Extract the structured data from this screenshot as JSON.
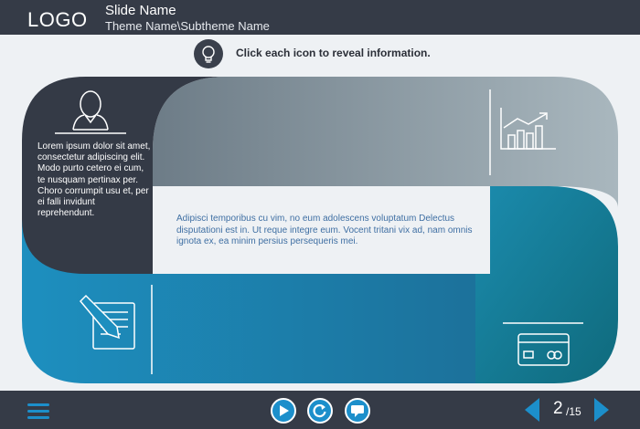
{
  "header": {
    "logo": "LOGO",
    "slide_name": "Slide Name",
    "theme_name": "Theme Name\\Subtheme Name"
  },
  "instruction": {
    "icon": "lightbulb-icon",
    "text": "Click each icon to reveal information."
  },
  "panels": {
    "profile_text": "Lorem ipsum dolor sit amet, consectetur adipiscing elit. Modo purto cetero ei cum, te nusquam pertinax per. Choro corrumpit usu et, per ei falli invidunt reprehendunt.",
    "center_text": "Adipisci temporibus cu vim, no eum adolescens voluptatum Delectus disputationi est in. Ut reque integre eum. Vocent tritani vix ad, nam omnis ignota ex, ea minim persius persequeris mei.",
    "icons": [
      "user-icon",
      "growth-chart-icon",
      "document-pencil-icon",
      "credit-card-icon"
    ]
  },
  "footer": {
    "menu_icon": "hamburger-menu-icon",
    "controls": [
      "play-icon",
      "replay-icon",
      "comment-icon"
    ],
    "page_current": "2",
    "page_total": "/15"
  },
  "colors": {
    "header_bg": "#353b47",
    "dark_panel": "#343a46",
    "gray_panel": "#8d9aa3",
    "teal_panel": "#137891",
    "blue_panel": "#1e8bb9",
    "accent": "#1c8fcb"
  }
}
